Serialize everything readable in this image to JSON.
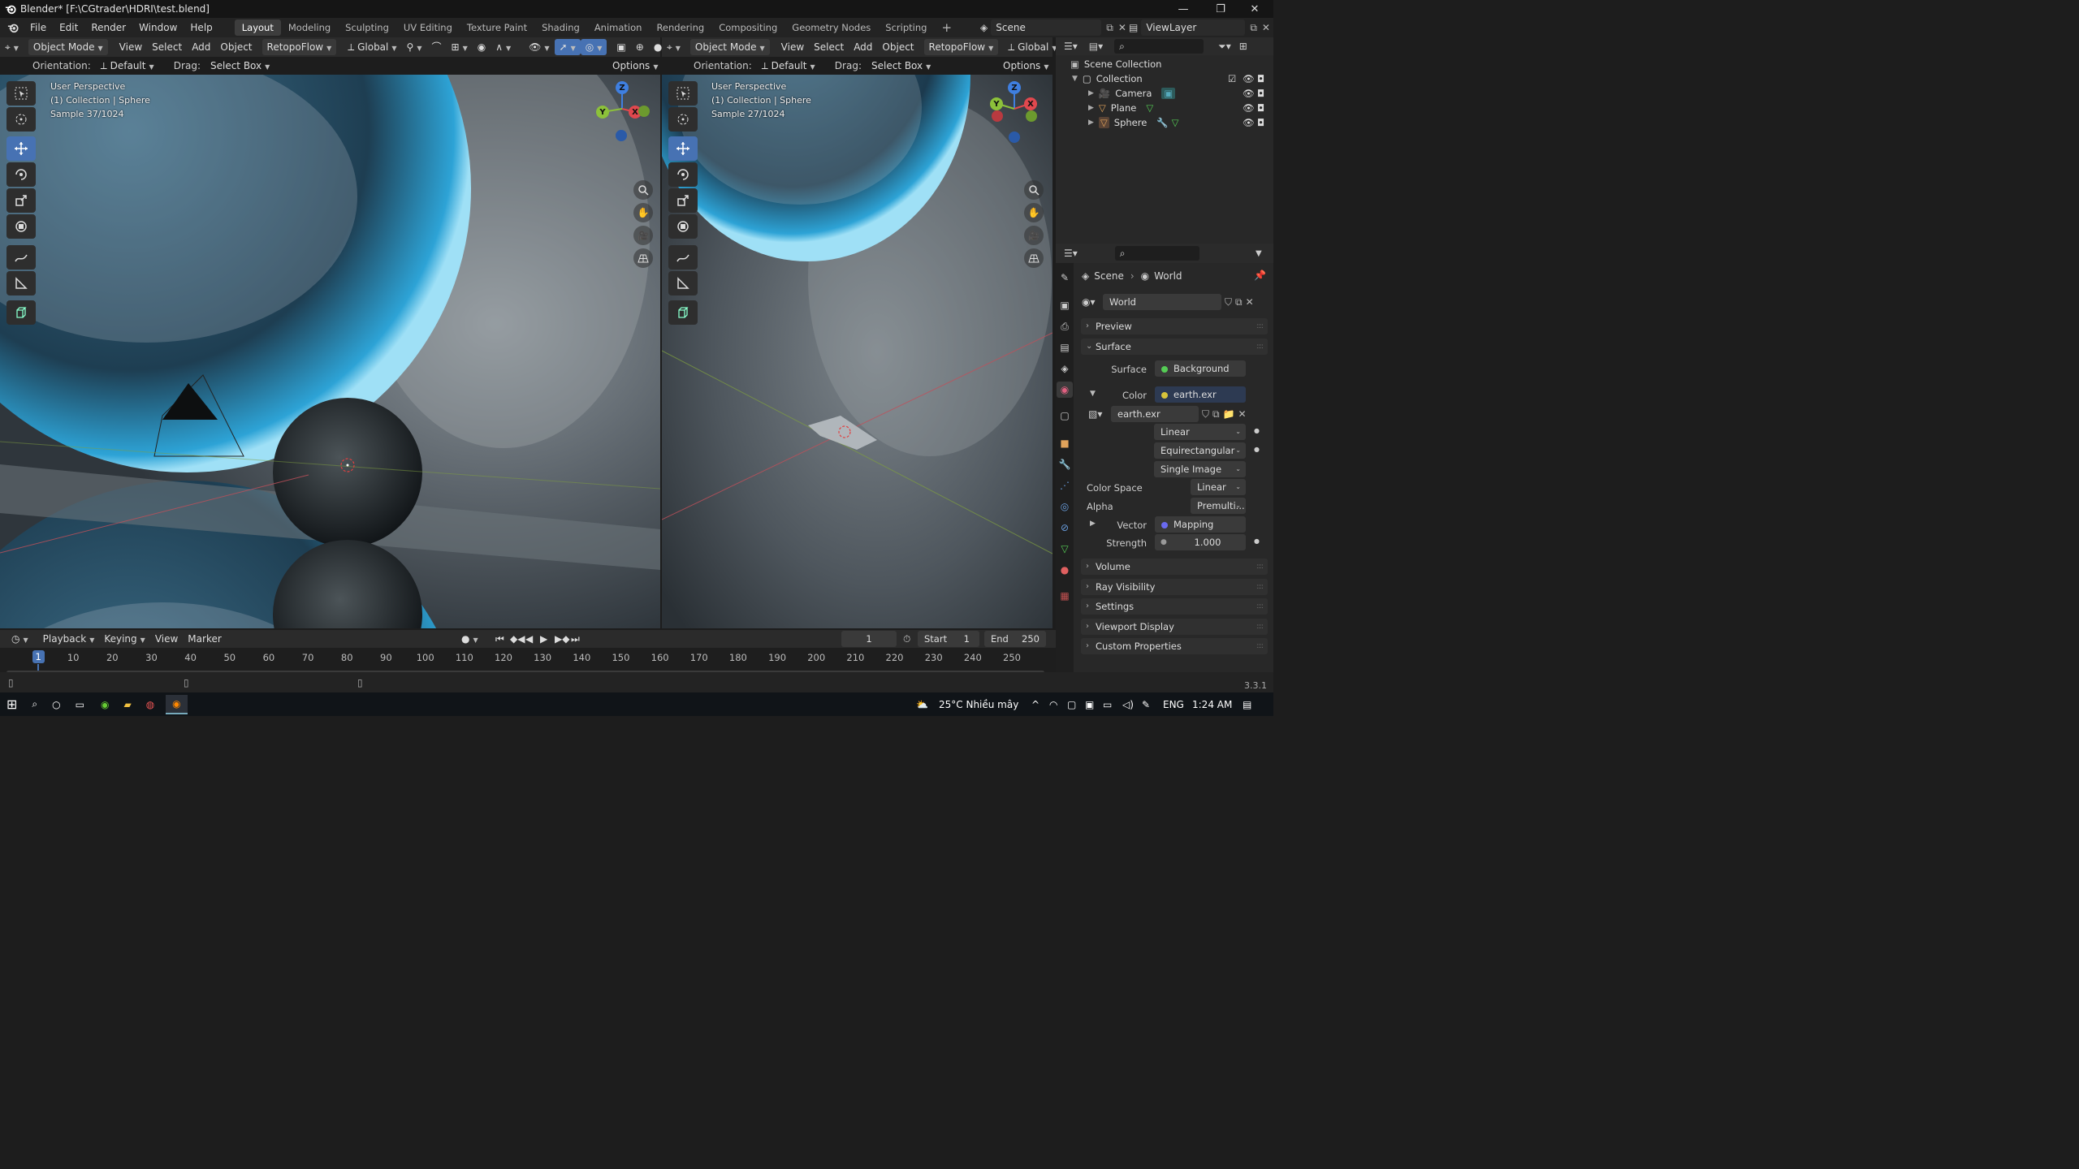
{
  "window": {
    "title": "Blender* [F:\\CGtrader\\HDRI\\test.blend]"
  },
  "menu": [
    "File",
    "Edit",
    "Render",
    "Window",
    "Help"
  ],
  "workspaces": [
    "Layout",
    "Modeling",
    "Sculpting",
    "UV Editing",
    "Texture Paint",
    "Shading",
    "Animation",
    "Rendering",
    "Compositing",
    "Geometry Nodes",
    "Scripting"
  ],
  "active_workspace": "Layout",
  "scene_field": "Scene",
  "viewlayer_field": "ViewLayer",
  "viewport_header": {
    "mode": "Object Mode",
    "menus": [
      "View",
      "Select",
      "Add",
      "Object"
    ],
    "addon": "RetopoFlow",
    "transform": "Global",
    "orientation_label": "Orientation:",
    "orientation_value": "Default",
    "drag_label": "Drag:",
    "drag_value": "Select Box",
    "options": "Options"
  },
  "viewport_left": {
    "line1": "User Perspective",
    "line2": "(1) Collection | Sphere",
    "line3": "Sample 37/1024"
  },
  "viewport_right": {
    "line1": "User Perspective",
    "line2": "(1) Collection | Sphere",
    "line3": "Sample 27/1024"
  },
  "gizmo_axes": {
    "x": "X",
    "y": "Y",
    "z": "Z"
  },
  "outliner": {
    "root": "Scene Collection",
    "collection": "Collection",
    "items": [
      "Camera",
      "Plane",
      "Sphere"
    ]
  },
  "properties": {
    "breadcrumb_scene": "Scene",
    "breadcrumb_world": "World",
    "world_name": "World",
    "panels": {
      "preview": "Preview",
      "surface": "Surface",
      "volume": "Volume",
      "ray_visibility": "Ray Visibility",
      "settings": "Settings",
      "viewport_display": "Viewport Display",
      "custom_properties": "Custom Properties"
    },
    "surface_label": "Surface",
    "surface_value": "Background",
    "color_label": "Color",
    "color_value": "earth.exr",
    "image_name": "earth.exr",
    "interpolation": "Linear",
    "projection": "Equirectangular",
    "source": "Single Image",
    "color_space_label": "Color Space",
    "color_space_value": "Linear",
    "alpha_label": "Alpha",
    "alpha_value": "Premulti...",
    "vector_label": "Vector",
    "vector_value": "Mapping",
    "strength_label": "Strength",
    "strength_value": "1.000"
  },
  "timeline": {
    "menus": [
      "Playback",
      "Keying",
      "View",
      "Marker"
    ],
    "current_frame": "1",
    "start_label": "Start",
    "start_value": "1",
    "end_label": "End",
    "end_value": "250",
    "ticks": [
      "1",
      "10",
      "20",
      "30",
      "40",
      "50",
      "60",
      "70",
      "80",
      "90",
      "100",
      "110",
      "120",
      "130",
      "140",
      "150",
      "160",
      "170",
      "180",
      "190",
      "200",
      "210",
      "220",
      "230",
      "240",
      "250"
    ]
  },
  "status": {
    "version": "3.3.1"
  },
  "taskbar": {
    "weather": "25°C  Nhiều mây",
    "language": "ENG",
    "time": "1:24 AM"
  },
  "colors": {
    "accent": "#4772b3",
    "x_axis": "#e0484e",
    "y_axis": "#8cc13a",
    "z_axis": "#3f7fe0",
    "frame_marker": "#4772b3"
  }
}
